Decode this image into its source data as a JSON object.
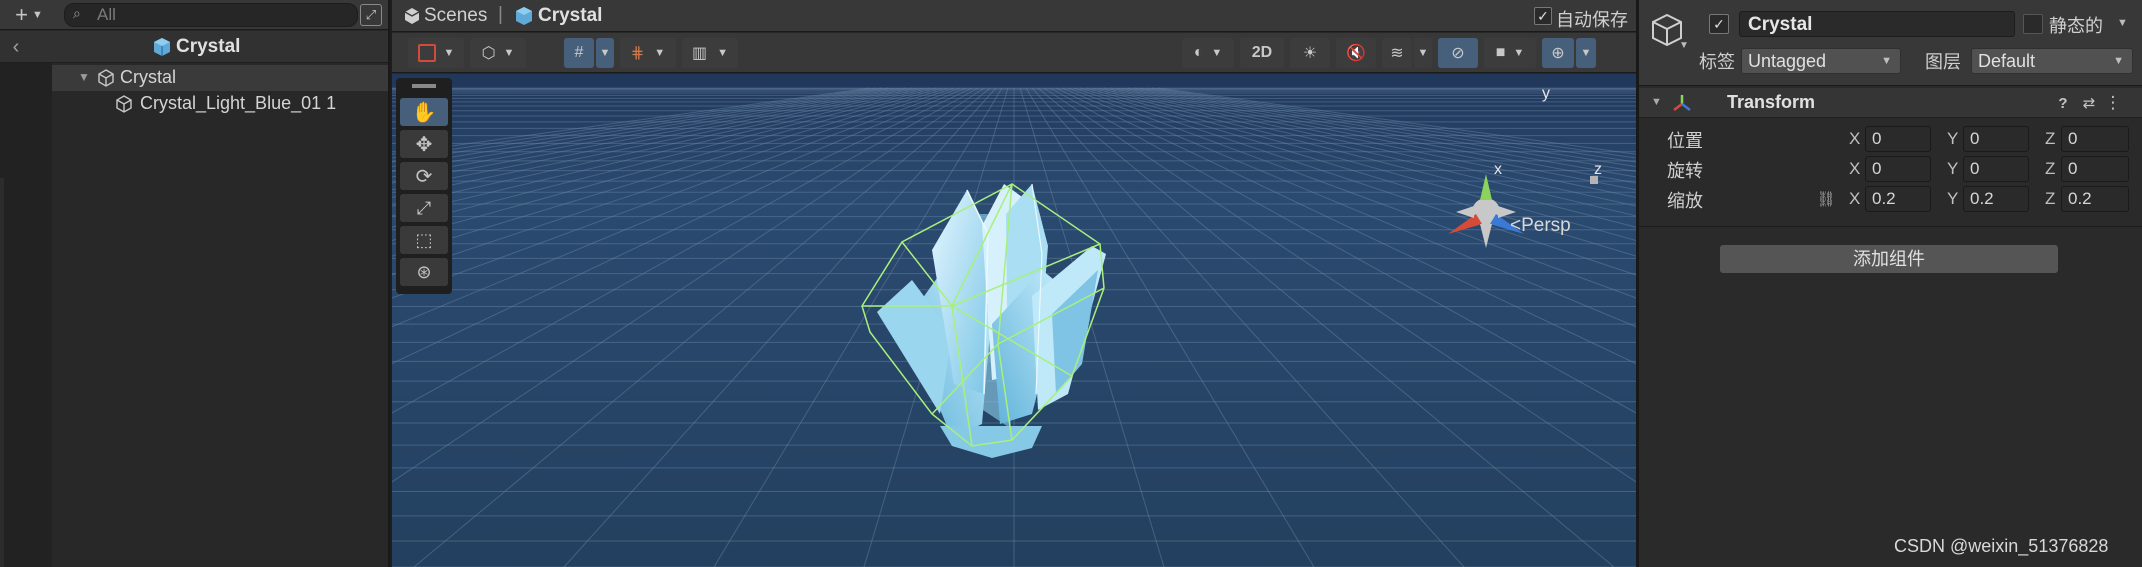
{
  "hierarchy": {
    "search_placeholder": "All",
    "scene_title": "Crystal",
    "root_label": "Crystal",
    "child_label": "Crystal_Light_Blue_01 1"
  },
  "scene": {
    "breadcrumb_root": "Scenes",
    "breadcrumb_current": "Crystal",
    "autosave_label": "自动保存",
    "mode_2d": "2D",
    "persp_label": "<Persp",
    "gizmo_x": "x",
    "gizmo_y": "y",
    "gizmo_z": "z"
  },
  "inspector": {
    "object_name": "Crystal",
    "static_label": "静态的",
    "tag_label": "标签",
    "tag_value": "Untagged",
    "layer_label": "图层",
    "layer_value": "Default",
    "transform_title": "Transform",
    "position_label": "位置",
    "rotation_label": "旋转",
    "scale_label": "缩放",
    "axis_x": "X",
    "axis_y": "Y",
    "axis_z": "Z",
    "position": {
      "x": "0",
      "y": "0",
      "z": "0"
    },
    "rotation": {
      "x": "0",
      "y": "0",
      "z": "0"
    },
    "scale": {
      "x": "0.2",
      "y": "0.2",
      "z": "0.2"
    },
    "add_component": "添加组件"
  },
  "watermark": "CSDN @weixin_51376828",
  "colors": {
    "accent": "#46607c",
    "scene_bg": "#25405f",
    "crystal": "#a8dcf0",
    "bounds": "#9ef07a"
  }
}
